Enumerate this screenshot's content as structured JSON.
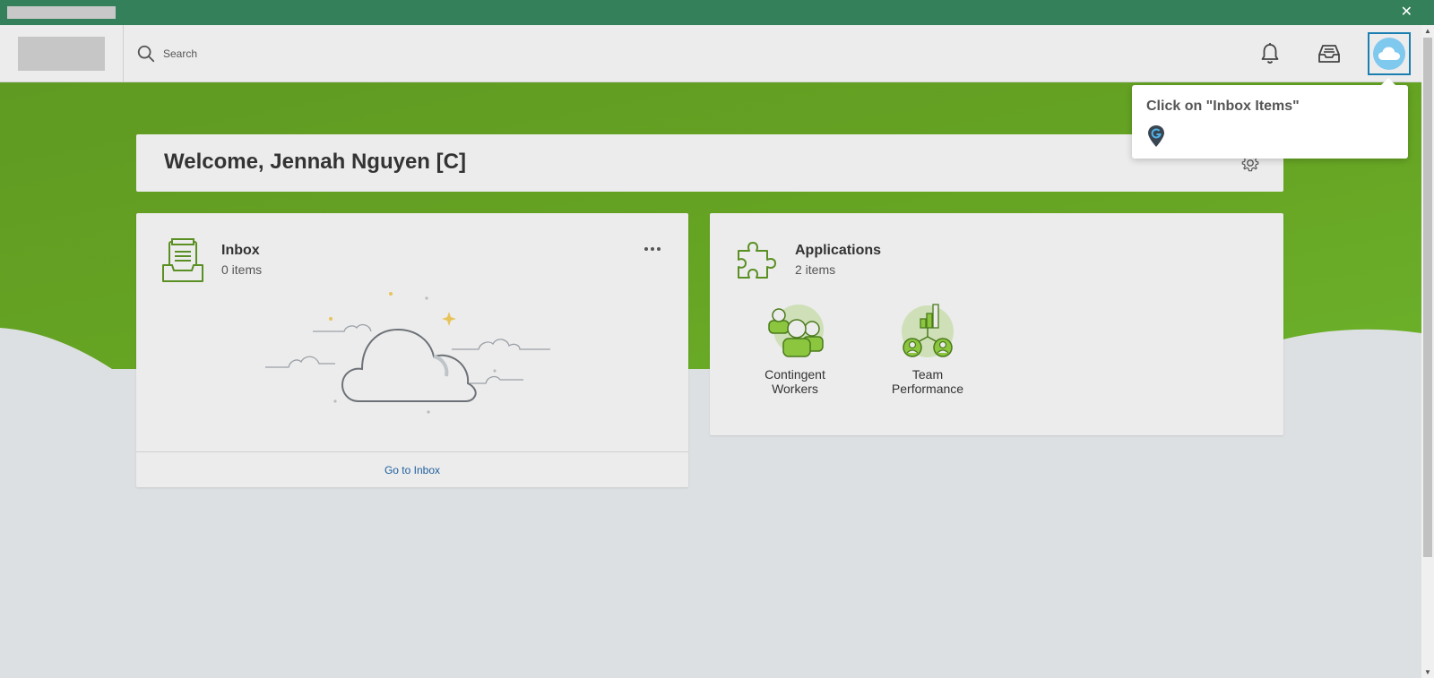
{
  "search": {
    "placeholder": "Search"
  },
  "welcome": {
    "title": "Welcome, Jennah Nguyen [C]"
  },
  "inbox": {
    "title": "Inbox",
    "count_label": "0 items",
    "footer_link": "Go to Inbox"
  },
  "applications": {
    "title": "Applications",
    "count_label": "2 items",
    "items": [
      {
        "label_line1": "Contingent",
        "label_line2": "Workers",
        "icon": "contingent-workers-icon"
      },
      {
        "label_line1": "Team",
        "label_line2": "Performance",
        "icon": "team-performance-icon"
      }
    ]
  },
  "tooltip": {
    "message": "Click on \"Inbox Items\""
  },
  "window": {
    "close_glyph": "✕"
  },
  "colors": {
    "topbar": "#33805a",
    "brand_green": "#6aa82a",
    "accent_blue": "#1a7fb0",
    "link": "#1f5f9e"
  }
}
